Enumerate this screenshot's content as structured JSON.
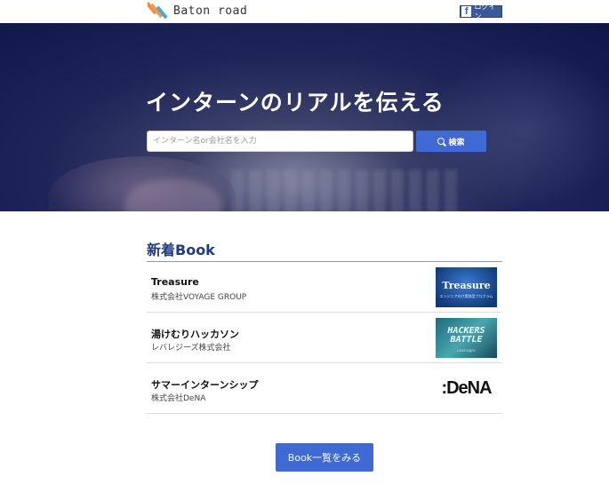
{
  "header": {
    "logo_text": "Baton road",
    "logo_colors": [
      "#f28a3a",
      "#4aa3df"
    ],
    "login_label": "ログイン",
    "login_icon": "facebook-icon"
  },
  "hero": {
    "title": "インターンのリアルを伝える",
    "search_placeholder": "インターン名or会社名を入力",
    "search_button": "検索",
    "search_icon": "search-icon"
  },
  "section": {
    "title": "新着Book"
  },
  "books": [
    {
      "title": "Treasure",
      "company": "株式会社VOYAGE GROUP",
      "thumb_text": "Treasure",
      "thumb_sub": "エンジニア向け実践型プログラム"
    },
    {
      "title": "湯けむりハッカソン",
      "company": "レバレジーズ株式会社",
      "thumb_text": "HACKERS BATTLE",
      "thumb_sub": "Leverages"
    },
    {
      "title": "サマーインターンシップ",
      "company": "株式会社DeNA",
      "thumb_text": ":DeNA",
      "thumb_sub": ""
    }
  ],
  "more_button": "Book一覧をみる",
  "colors": {
    "accent": "#3f6ad3",
    "section_title": "#1f3b82",
    "facebook": "#3b5998"
  }
}
